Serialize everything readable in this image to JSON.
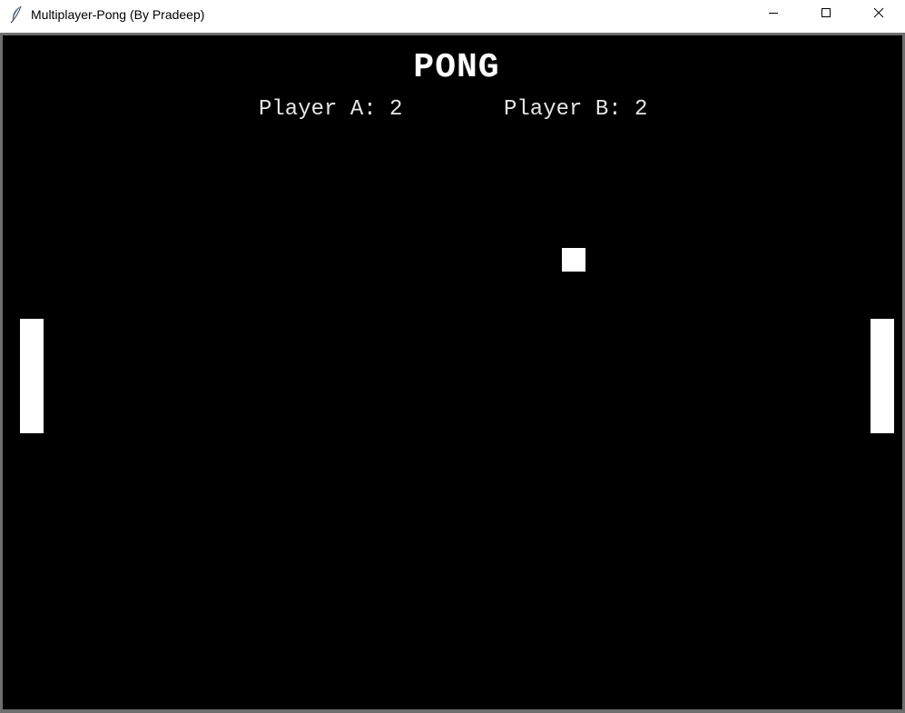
{
  "window": {
    "title": "Multiplayer-Pong (By Pradeep)",
    "icon": "feather-icon",
    "controls": [
      "minimize-icon",
      "maximize-icon",
      "close-icon"
    ]
  },
  "game": {
    "title": "PONG",
    "score_a": "Player A: 2",
    "score_b": "Player B: 2",
    "background_color": "#000000",
    "foreground_color": "#ffffff"
  }
}
